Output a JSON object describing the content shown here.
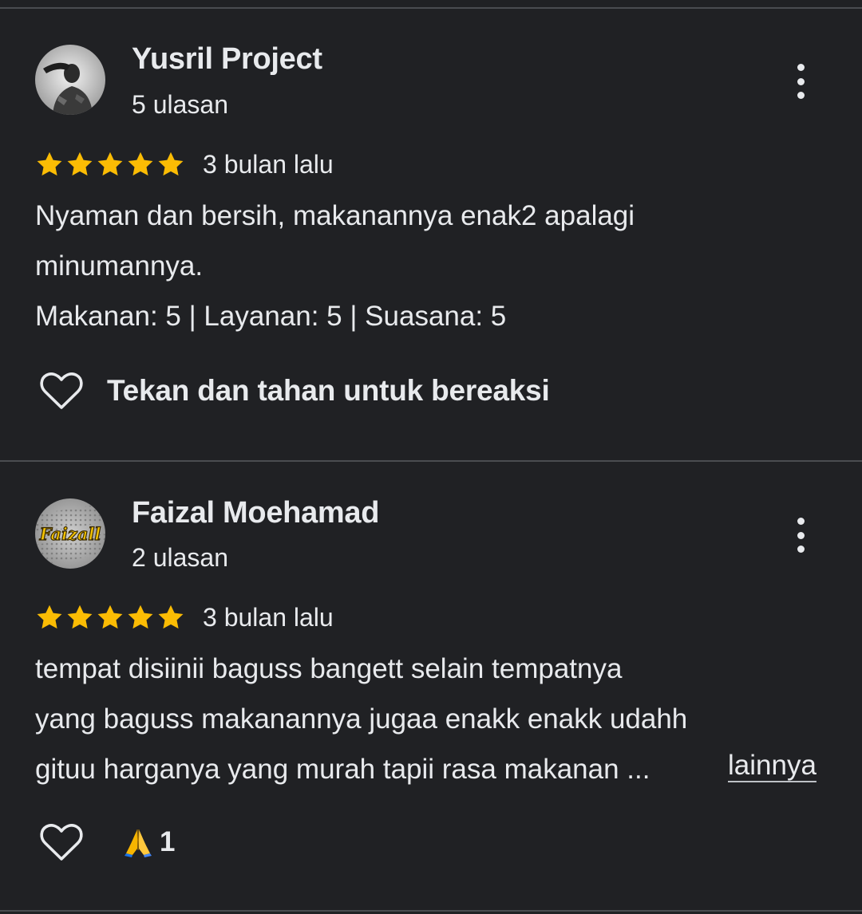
{
  "reviews": [
    {
      "author": "Yusril Project",
      "review_count": "5 ulasan",
      "avatar_icon": "person-saluting-photo",
      "rating": 5,
      "time": "3 bulan lalu",
      "text_lines": [
        "Nyaman dan bersih, makanannya enak2 apalagi",
        "minumannya.",
        "Makanan: 5 | Layanan: 5 | Suasana: 5"
      ],
      "react_label": "Tekan dan tahan untuk bereaksi"
    },
    {
      "author": "Faizal Moehamad",
      "review_count": "2 ulasan",
      "avatar_icon": "faizall-logo",
      "avatar_text": "Faizall",
      "rating": 5,
      "time": "3 bulan lalu",
      "text_lines": [
        "tempat disiinii baguss bangett selain tempatnya",
        "yang baguss makanannya jugaa enakk enakk udahh",
        "gituu harganya yang murah tapii rasa makanan ..."
      ],
      "more_label": "lainnya",
      "reaction_emoji": "folded-hands-emoji",
      "reaction_count": "1"
    }
  ],
  "colors": {
    "background": "#202124",
    "text": "#e8eaed",
    "star": "#fbbc04",
    "divider": "#4a4c50"
  }
}
